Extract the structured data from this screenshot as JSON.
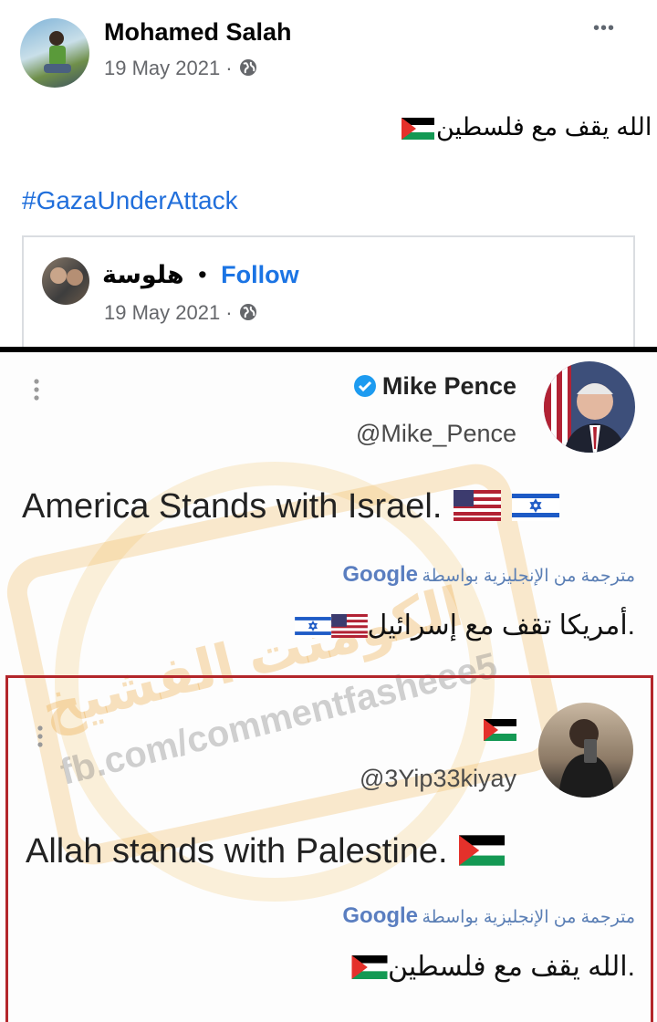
{
  "post": {
    "author": "Mohamed Salah",
    "date": "19 May 2021 · ",
    "text": "الله يقف مع فلسطين",
    "hashtag": "#GazaUnderAttack",
    "more_label": "•••"
  },
  "shared": {
    "author": "هلوسة",
    "dot": "•",
    "follow_label": "Follow",
    "date": "19 May 2021 · "
  },
  "tweet1": {
    "name": "Mike Pence",
    "handle": "@Mike_Pence",
    "text": "America Stands with Israel.",
    "translated_by": "مترجمة من الإنجليزية بواسطة",
    "google": "Google",
    "translation": "أمريكا تقف مع إسرائيل."
  },
  "tweet2": {
    "handle": "@3Yip33kiyay",
    "text": "Allah stands with Palestine.",
    "translated_by": "مترجمة من الإنجليزية بواسطة",
    "google": "Google",
    "translation": "الله يقف مع فلسطين."
  },
  "watermark": {
    "url": "fb.com/commentfasheee5",
    "arabic": "الكومنت الفشيخ"
  },
  "icons": {
    "globe": "globe-icon",
    "verified": "verified-badge-icon",
    "more": "more-options-icon",
    "kebab": "kebab-menu-icon"
  },
  "colors": {
    "link": "#1b74e4",
    "hashtag": "#216fdb",
    "verified": "#1d9bf0",
    "frame": "#b3262b"
  }
}
